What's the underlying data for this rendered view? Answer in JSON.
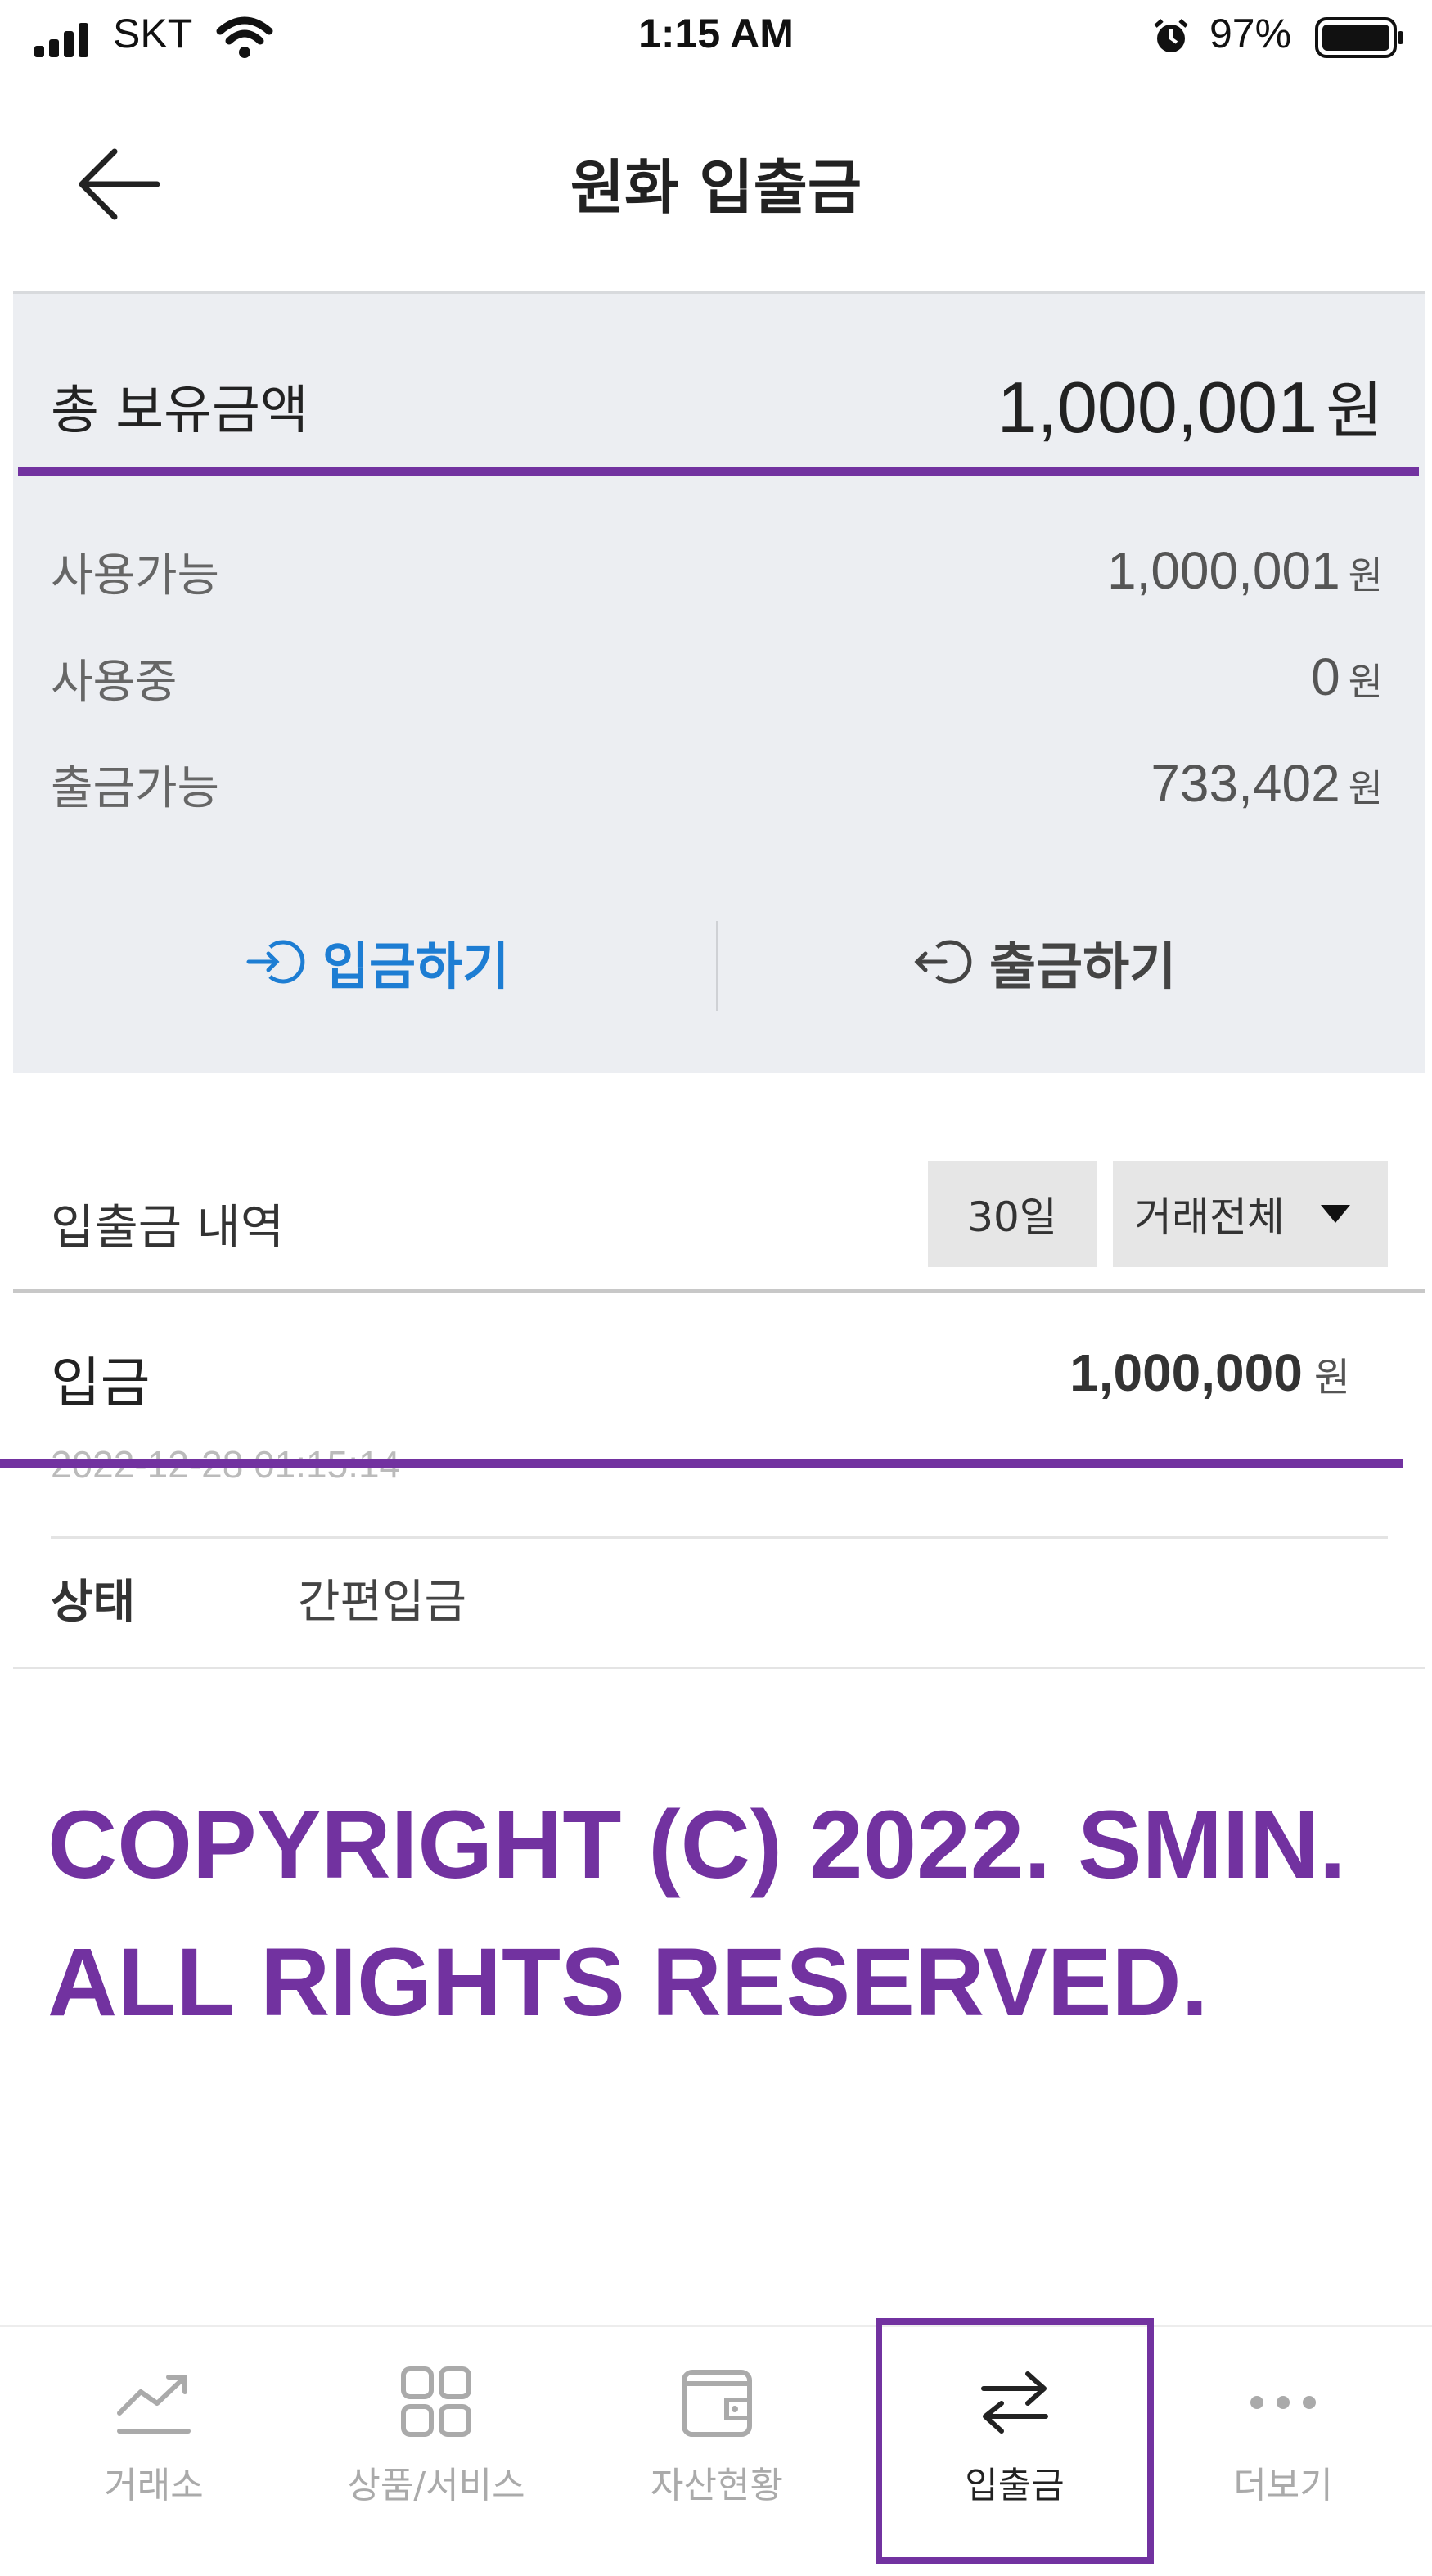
{
  "status_bar": {
    "carrier": "SKT",
    "time": "1:15 AM",
    "battery": "97%"
  },
  "header": {
    "title": "원화 입출금"
  },
  "summary": {
    "total_label": "총 보유금액",
    "total_value": "1,000,001",
    "total_unit": "원",
    "rows": [
      {
        "label": "사용가능",
        "value": "1,000,001",
        "unit": "원"
      },
      {
        "label": "사용중",
        "value": "0",
        "unit": "원"
      },
      {
        "label": "출금가능",
        "value": "733,402",
        "unit": "원"
      }
    ],
    "deposit_label": "입금하기",
    "withdraw_label": "출금하기"
  },
  "history": {
    "title": "입출금 내역",
    "period_filter": "30일",
    "type_filter": "거래전체",
    "entries": [
      {
        "type": "입금",
        "amount": "1,000,000",
        "unit": "원",
        "datetime": "2022-12-28 01:15:14",
        "status_key": "상태",
        "status_value": "간편입금"
      }
    ]
  },
  "watermark": {
    "line1": "COPYRIGHT (C) 2022. SMIN.",
    "line2": "ALL RIGHTS RESERVED."
  },
  "tabbar": {
    "active": "입출금",
    "tabs": [
      {
        "label": "거래소",
        "icon": "chart-trend-icon"
      },
      {
        "label": "상품/서비스",
        "icon": "grid-icon"
      },
      {
        "label": "자산현황",
        "icon": "wallet-icon"
      },
      {
        "label": "입출금",
        "icon": "transfer-arrows-icon"
      },
      {
        "label": "더보기",
        "icon": "more-dots-icon"
      }
    ]
  },
  "colors": {
    "accent_purple": "#7232a0",
    "deposit_blue": "#1d7dd3",
    "panel_bg": "#eceef2"
  }
}
